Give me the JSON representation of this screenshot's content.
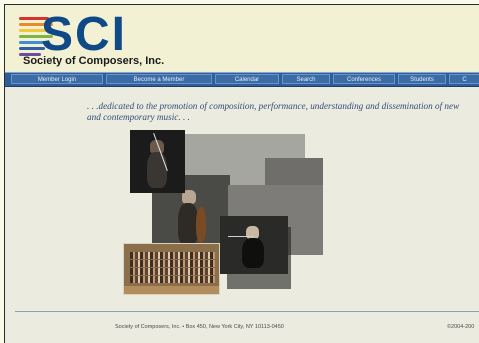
{
  "header": {
    "logo_text": "SCI",
    "org_name": "Society of Composers, Inc."
  },
  "nav": {
    "items": [
      {
        "label": "Member Login"
      },
      {
        "label": "Become a Member"
      },
      {
        "label": "Calendar"
      },
      {
        "label": "Search"
      },
      {
        "label": "Conferences"
      },
      {
        "label": "Students"
      },
      {
        "label": "C"
      }
    ]
  },
  "tagline": ". . .dedicated to the promotion of composition, performance, understanding and dissemination of new and contemporary music. . .",
  "footer": {
    "address": "Society of Composers, Inc. • Box 450, New York City, NY 10113-0450",
    "copyright": "©2004-200"
  },
  "colors": {
    "brand_blue": "#0f4a86",
    "nav_blue": "#2f5f9a",
    "page_bg": "#ecebe0",
    "header_bg": "#f3f1d4"
  },
  "icons": [
    "sci-logo-stripes"
  ]
}
